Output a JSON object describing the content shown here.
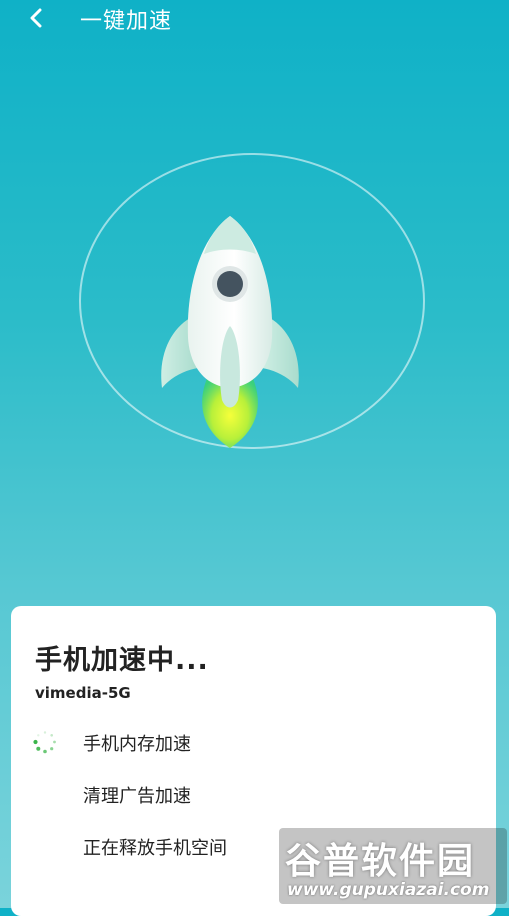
{
  "header": {
    "back_icon": "chevron-left-icon",
    "title": "一键加速"
  },
  "hero": {
    "icon": "rocket-icon"
  },
  "progress_card": {
    "title": "手机加速中...",
    "network": "vimedia-5G",
    "tasks": [
      {
        "label": "手机内存加速",
        "state": "running",
        "icon": "spinner-icon"
      },
      {
        "label": "清理广告加速",
        "state": "pending"
      },
      {
        "label": "正在释放手机空间",
        "state": "pending"
      }
    ]
  },
  "watermark": {
    "brand": "谷普软件园",
    "url": "www.gupuxiazai.com"
  },
  "colors": {
    "bg_top": "#0fb1c7",
    "bg_bottom": "#7ad3db",
    "spinner": "#3bb54a"
  }
}
